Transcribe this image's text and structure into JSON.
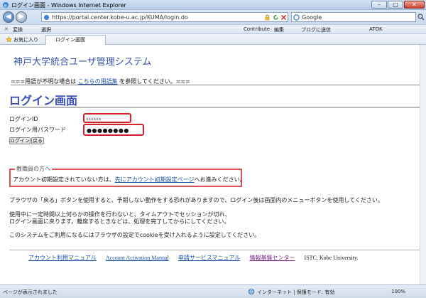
{
  "window": {
    "title": "ログイン画面 - Windows Internet Explorer",
    "minimize": "–",
    "maximize": "□",
    "close": "✕"
  },
  "nav": {
    "back": "◀",
    "forward": "▶",
    "address": "https://portal.center.kobe-u.ac.jp/KUMA/login.do",
    "search_placeholder": "Google"
  },
  "toolbar": {
    "close_x": "✕",
    "convert": "変換",
    "select": "選択",
    "contribute": "Contribute",
    "edit": "編集",
    "blog_post": "ブログに送信",
    "atok": "ATOK"
  },
  "favorites": {
    "label": "お気に入り",
    "tab_title": "ログイン画面"
  },
  "page": {
    "site_title": "神戸大学統合ユーザ管理システム",
    "notice_prefix": "===用語が不明な場合は",
    "notice_link": "こちらの用語集",
    "notice_suffix": "を参照してください。===",
    "heading": "ログイン画面",
    "uid_label": "ログインID",
    "uid_value": "xxxxxx",
    "pw_label": "ログイン用パスワード",
    "pw_value": "●●●●●●●●",
    "login_button": "ログイン",
    "back_button": "戻る",
    "staff_legend": "教職員の方へ",
    "staff_prefix": "アカウント初期設定されていない方は、",
    "staff_link": "先にアカウント初期設定ページ",
    "staff_suffix": "へお進みください。",
    "para1": "ブラウザの「戻る」ボタンを使用すると、予期しない動作をする恐れがありますので、ログイン後は画面内のメニューボタンを使用してください。",
    "para2_line1": "使用中に一定時間以上何らかの操作を行わないと、タイムアウトでセッションが切れ、",
    "para2_line2": "ログイン画面に戻ります。離席するときなどは、処理を完了してからにしてください。",
    "para3": "このシステムをご利用になるにはブラウザの設定でcookieを受け入れるように設定してください。"
  },
  "footer": {
    "link1": "アカウント利用マニュアル",
    "link2": "Account Activation Manual",
    "link3": "申請サービスマニュアル",
    "link4": "情報基盤センター",
    "credit": "ISTC, Kobe University."
  },
  "status": {
    "message": "ページが表示されました",
    "zone": "インターネット | 保護モード: 有効",
    "zoom": "100%"
  },
  "colors": {
    "accent": "#3d4fb8",
    "link": "#1a55a8",
    "highlight": "#d8202c"
  }
}
